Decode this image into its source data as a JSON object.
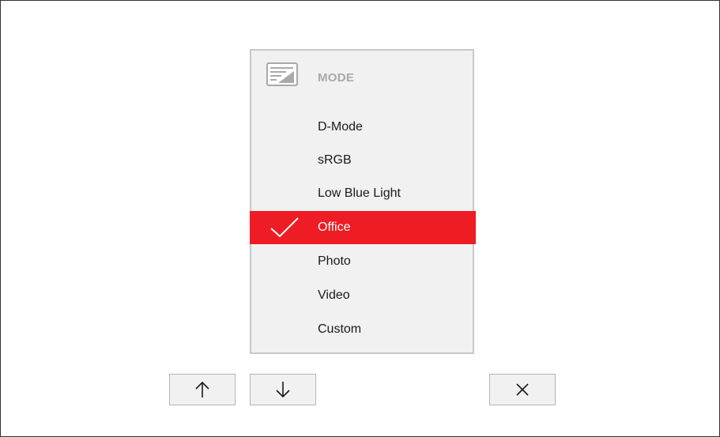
{
  "menu": {
    "title": "MODE",
    "title_icon": "mode-icon",
    "items": [
      {
        "label": "D-Mode",
        "selected": false
      },
      {
        "label": "sRGB",
        "selected": false
      },
      {
        "label": "Low Blue Light",
        "selected": false
      },
      {
        "label": "Office",
        "selected": true
      },
      {
        "label": "Photo",
        "selected": false
      },
      {
        "label": "Video",
        "selected": false
      },
      {
        "label": "Custom",
        "selected": false
      }
    ]
  },
  "buttons": {
    "up_icon": "arrow-up-icon",
    "down_icon": "arrow-down-icon",
    "close_icon": "close-icon"
  },
  "colors": {
    "selected_bg": "#ee1c24",
    "menu_bg": "#f0f1f0",
    "header_text": "#a9a9a9"
  }
}
